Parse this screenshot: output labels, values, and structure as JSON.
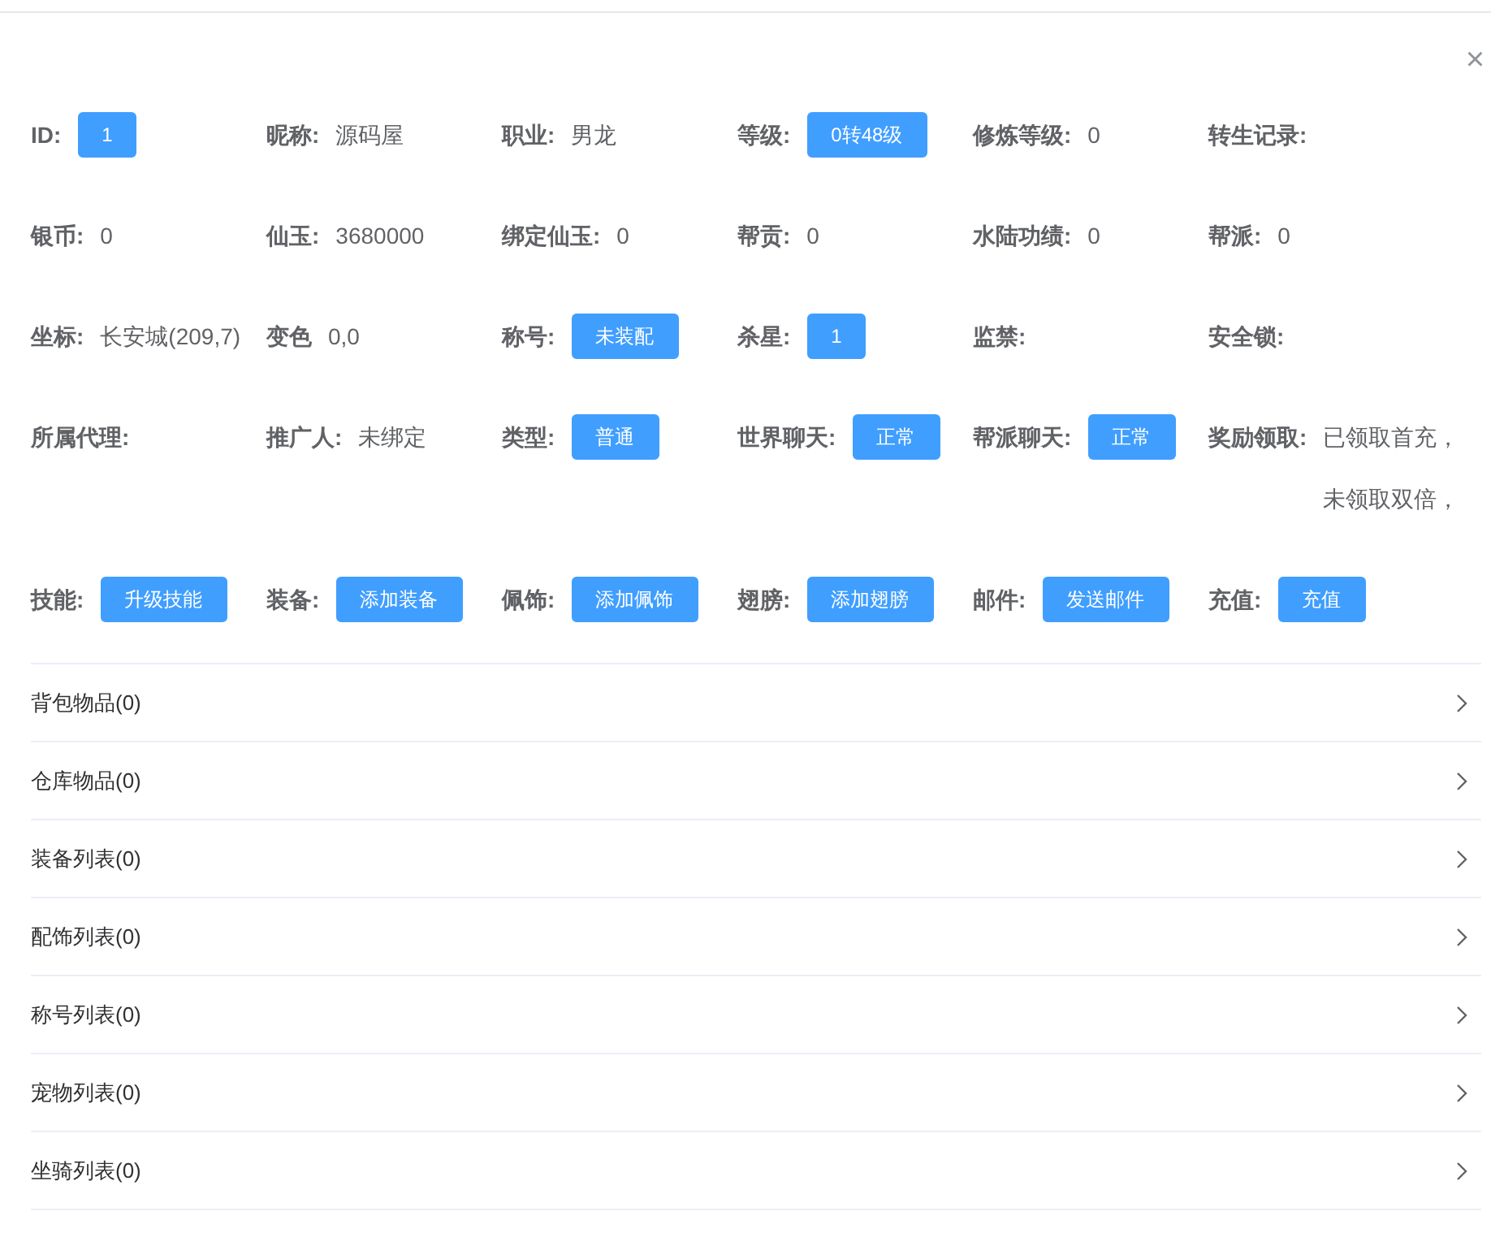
{
  "dialog": {
    "close": "×"
  },
  "fields": [
    {
      "label": "ID:",
      "kind": "button",
      "value": "1"
    },
    {
      "label": "昵称:",
      "kind": "text",
      "value": "源码屋"
    },
    {
      "label": "职业:",
      "kind": "text",
      "value": "男龙"
    },
    {
      "label": "等级:",
      "kind": "button",
      "value": "0转48级"
    },
    {
      "label": "修炼等级:",
      "kind": "text",
      "value": "0"
    },
    {
      "label": "转生记录:",
      "kind": "none"
    },
    {
      "label": "银币:",
      "kind": "text",
      "value": "0"
    },
    {
      "label": "仙玉:",
      "kind": "text",
      "value": "3680000"
    },
    {
      "label": "绑定仙玉:",
      "kind": "text",
      "value": "0"
    },
    {
      "label": "帮贡:",
      "kind": "text",
      "value": "0"
    },
    {
      "label": "水陆功绩:",
      "kind": "text",
      "value": "0"
    },
    {
      "label": "帮派:",
      "kind": "text",
      "value": "0"
    },
    {
      "label": "坐标:",
      "kind": "text",
      "value": "长安城(209,7)"
    },
    {
      "label": "变色",
      "kind": "text",
      "value": "0,0"
    },
    {
      "label": "称号:",
      "kind": "button",
      "value": "未装配"
    },
    {
      "label": "杀星:",
      "kind": "button",
      "value": "1"
    },
    {
      "label": "监禁:",
      "kind": "none"
    },
    {
      "label": "安全锁:",
      "kind": "none"
    },
    {
      "label": "所属代理:",
      "kind": "none"
    },
    {
      "label": "推广人:",
      "kind": "text",
      "value": "未绑定"
    },
    {
      "label": "类型:",
      "kind": "button",
      "value": "普通"
    },
    {
      "label": "世界聊天:",
      "kind": "button",
      "value": "正常"
    },
    {
      "label": "帮派聊天:",
      "kind": "button",
      "value": "正常"
    },
    {
      "label": "奖励领取:",
      "kind": "text",
      "value": "已领取首充，未领取双倍，"
    },
    {
      "label": "技能:",
      "kind": "button",
      "value": "升级技能"
    },
    {
      "label": "装备:",
      "kind": "button",
      "value": "添加装备"
    },
    {
      "label": "佩饰:",
      "kind": "button",
      "value": "添加佩饰"
    },
    {
      "label": "翅膀:",
      "kind": "button",
      "value": "添加翅膀"
    },
    {
      "label": "邮件:",
      "kind": "button",
      "value": "发送邮件"
    },
    {
      "label": "充值:",
      "kind": "button",
      "value": "充值"
    }
  ],
  "sections": [
    {
      "title": "背包物品(0)",
      "expanded": false
    },
    {
      "title": "仓库物品(0)",
      "expanded": false
    },
    {
      "title": "装备列表(0)",
      "expanded": false
    },
    {
      "title": "配饰列表(0)",
      "expanded": false
    },
    {
      "title": "称号列表(0)",
      "expanded": false
    },
    {
      "title": "宠物列表(0)",
      "expanded": false
    },
    {
      "title": "坐骑列表(0)",
      "expanded": false
    }
  ]
}
